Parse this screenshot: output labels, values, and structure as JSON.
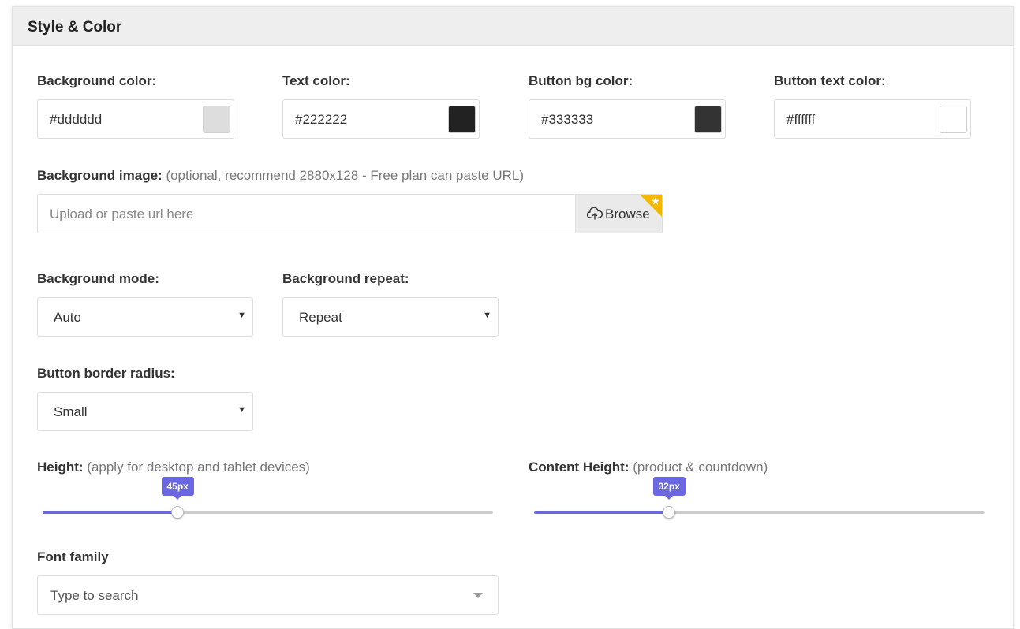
{
  "panel": {
    "title": "Style & Color"
  },
  "colors": [
    {
      "label": "Background color:",
      "value": "#dddddd",
      "swatch": "#dddddd"
    },
    {
      "label": "Text color:",
      "value": "#222222",
      "swatch": "#222222"
    },
    {
      "label": "Button bg color:",
      "value": "#333333",
      "swatch": "#333333"
    },
    {
      "label": "Button text color:",
      "value": "#ffffff",
      "swatch": "#ffffff"
    }
  ],
  "background_image": {
    "label": "Background image:",
    "hint": "(optional, recommend 2880x128 - Free plan can paste URL)",
    "placeholder": "Upload or paste url here",
    "browse_label": "Browse",
    "browse_icon": "cloud-upload-icon",
    "premium_icon": "star-icon"
  },
  "background_mode": {
    "label": "Background mode:",
    "value": "Auto"
  },
  "background_repeat": {
    "label": "Background repeat:",
    "value": "Repeat"
  },
  "button_border_radius": {
    "label": "Button border radius:",
    "value": "Small"
  },
  "height": {
    "label": "Height:",
    "hint": "(apply for desktop and tablet devices)",
    "value_label": "45px",
    "fraction": 0.3
  },
  "content_height": {
    "label": "Content Height:",
    "hint": "(product & countdown)",
    "value_label": "32px",
    "fraction": 0.3
  },
  "font_family": {
    "label": "Font family",
    "placeholder": "Type to search"
  },
  "theme": {
    "accent": "#6b67e0",
    "premium": "#f5b800"
  }
}
